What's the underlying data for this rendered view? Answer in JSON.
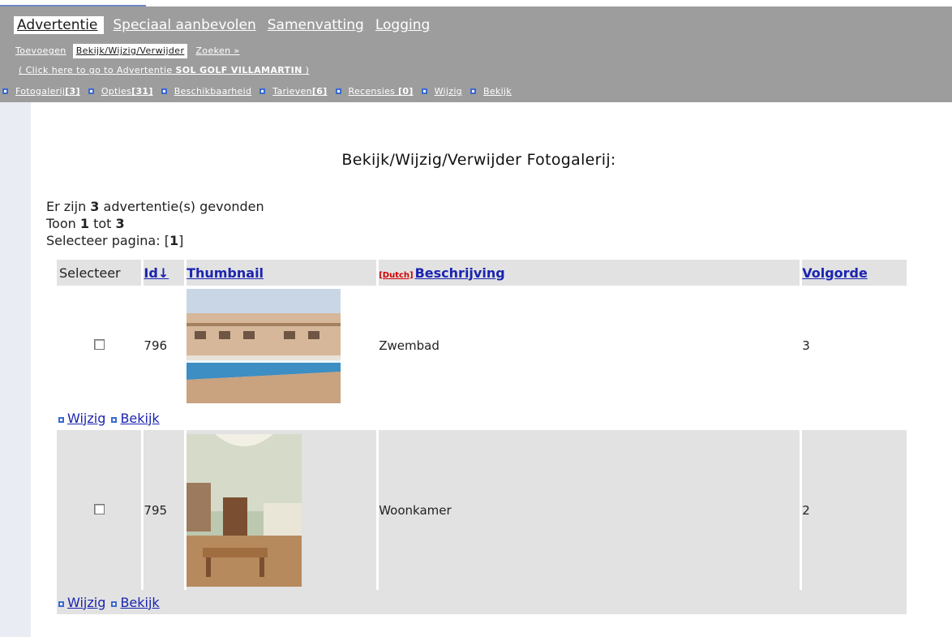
{
  "nav": {
    "main_tabs": [
      "Advertentie",
      "Speciaal aanbevolen",
      "Samenvatting",
      "Logging"
    ],
    "sub_tabs": [
      "Toevoegen",
      "Bekijk/Wijzig/Verwijder",
      "Zoeken »"
    ],
    "click_line_prefix": "( Click here to go to Advertentie ",
    "click_line_name": "SOL GOLF VILLAMARTIN",
    "click_line_suffix": " )",
    "sections": [
      {
        "label": "Fotogalerij",
        "count": "[3]"
      },
      {
        "label": "Opties",
        "count": "[31]"
      },
      {
        "label": "Beschikbaarheid",
        "count": ""
      },
      {
        "label": "Tarieven",
        "count": "[6]"
      },
      {
        "label": "Recensies ",
        "count": "[0]"
      },
      {
        "label": "Wijzig",
        "count": ""
      },
      {
        "label": "Bekijk",
        "count": ""
      }
    ]
  },
  "main": {
    "title": "Bekijk/Wijzig/Verwijder Fotogalerij:",
    "found_prefix": "Er zijn ",
    "found_count": "3",
    "found_suffix": " advertentie(s) gevonden",
    "show_prefix": "Toon ",
    "show_from": "1",
    "show_mid": " tot ",
    "show_to": "3",
    "page_prefix": "Selecteer pagina: [",
    "page_current": "1",
    "page_suffix": "]"
  },
  "table": {
    "headers": {
      "select": "Selecteer",
      "id": "Id↓",
      "thumbnail": "Thumbnail",
      "lang": "[Dutch]",
      "description": "Beschrijving",
      "order": "Volgorde"
    },
    "rows": [
      {
        "id": "796",
        "description": "Zwembad",
        "order": "3",
        "thumb_icon": "pool-photo"
      },
      {
        "id": "795",
        "description": "Woonkamer",
        "order": "2",
        "thumb_icon": "living-room-photo"
      }
    ],
    "action_edit": "Wijzig",
    "action_view": "Bekijk"
  },
  "colors": {
    "header_bg": "#9d9d9d",
    "link": "#1a24b0",
    "row_alt": "#e2e2e2",
    "lang_tag": "#d10000"
  }
}
